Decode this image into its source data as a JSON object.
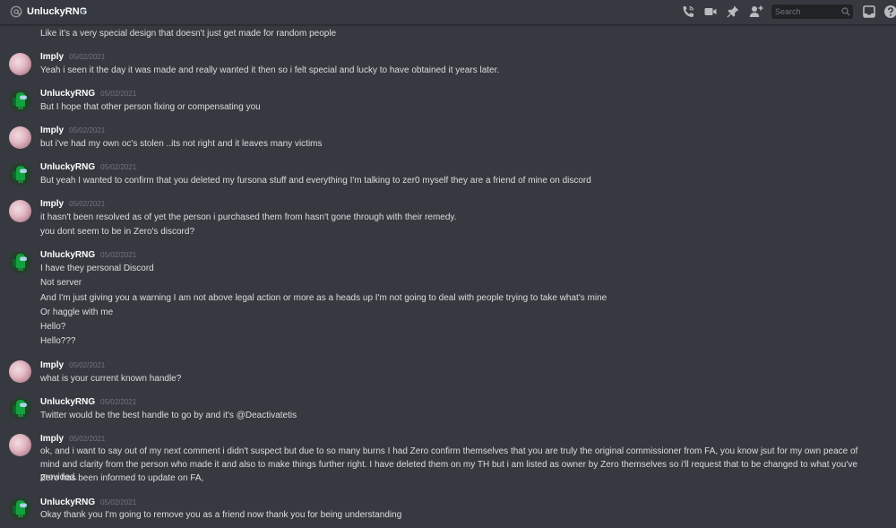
{
  "header": {
    "channel_name": "UnluckyRNG",
    "icons": [
      "at-icon",
      "phone-icon",
      "video-icon",
      "pin-icon",
      "add-friend-icon",
      "search-icon",
      "inbox-icon",
      "help-icon"
    ],
    "search_placeholder": "Search"
  },
  "messages": {
    "top_line": "Like it's a very special design that doesn't just get made for random people",
    "groups": [
      {
        "author": "Imply",
        "time": "05/02/2021",
        "lines": [
          "Yeah i seen it the day it was made and really wanted it then so i felt special and lucky to have obtained it years later."
        ]
      },
      {
        "author": "UnluckyRNG",
        "time": "05/02/2021",
        "lines": [
          "But I hope that other person fixing or compensating you"
        ]
      },
      {
        "author": "Imply",
        "time": "05/02/2021",
        "lines": [
          "but i've had my own oc's stolen ..its not right and it leaves many victims"
        ]
      },
      {
        "author": "UnluckyRNG",
        "time": "05/02/2021",
        "lines": [
          "But yeah I wanted to confirm that you deleted my fursona stuff and everything I'm talking to zer0 myself they are a friend of mine on discord"
        ]
      },
      {
        "author": "Imply",
        "time": "05/02/2021",
        "lines": [
          "it hasn't been resolved as of yet the person i purchased them from hasn't gone through with their remedy.",
          "you dont seem to be in Zero's discord?"
        ]
      },
      {
        "author": "UnluckyRNG",
        "time": "05/02/2021",
        "lines": [
          "I have they personal Discord",
          "Not server",
          "And I'm just giving you a warning I am not above legal action or more as a heads up I'm not going to deal with people trying to take what's mine",
          "Or haggle with me",
          "Hello?",
          "Hello???"
        ]
      },
      {
        "author": "Imply",
        "time": "05/02/2021",
        "lines": [
          "what is your current known handle?"
        ]
      },
      {
        "author": "UnluckyRNG",
        "time": "05/02/2021",
        "lines": [
          "Twitter would be the best handle to go by and it's @Deactivatetis"
        ]
      },
      {
        "author": "Imply",
        "time": "05/02/2021",
        "lines": [
          "ok, and i want to say out of my next comment i didn't suspect but due to so many burns I had Zero confirm themselves that you are truly the original commissioner from FA,  you know jsut for my own peace of mind and clarity from the person who made it and also to make things further right. I have deleted them on my TH but i am listed as owner by Zero themselves so i'll request that to be changed to what you've provided.",
          "Zero has been informed to update on FA,"
        ]
      },
      {
        "author": "UnluckyRNG",
        "time": "05/02/2021",
        "lines": [
          "Okay thank you I'm going to remove you as a friend now thank you for being understanding"
        ]
      }
    ]
  }
}
